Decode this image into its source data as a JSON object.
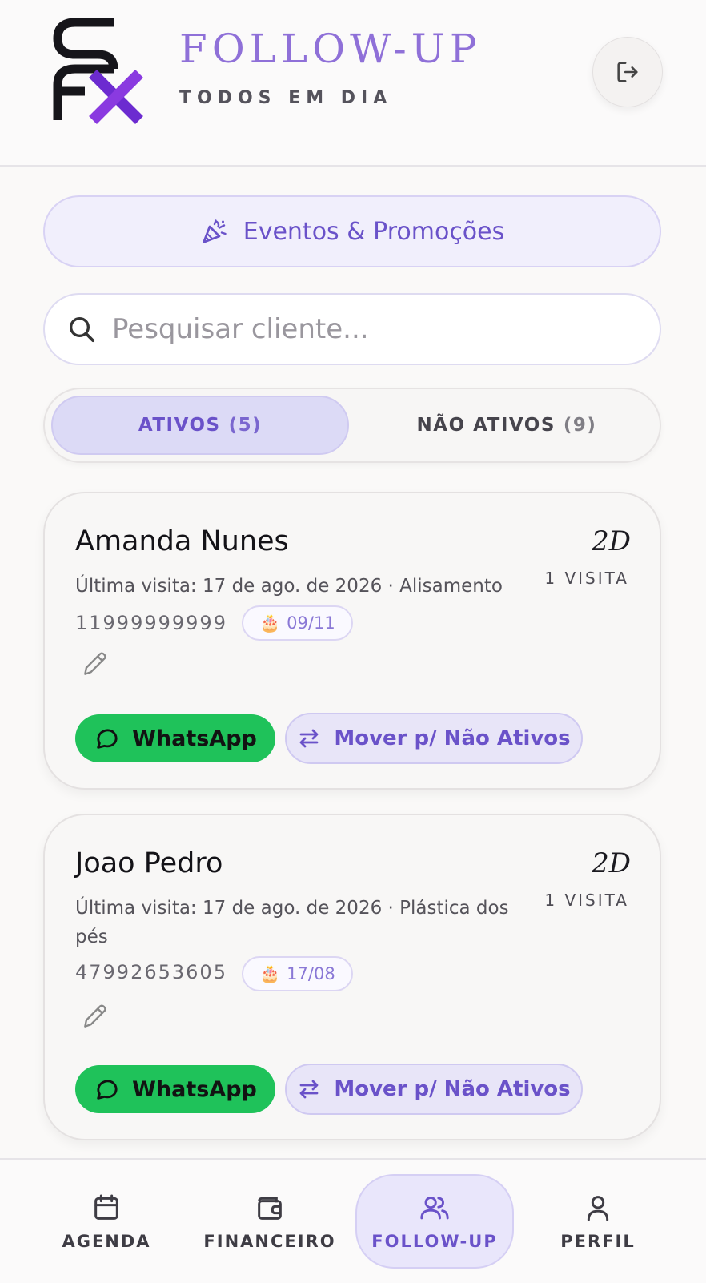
{
  "header": {
    "logo_text": "SFX",
    "title": "FOLLOW-UP",
    "subtitle": "TODOS EM DIA",
    "logout_icon": "logout-icon"
  },
  "promo": {
    "label": "Eventos & Promoções",
    "icon": "party-popper-icon"
  },
  "search": {
    "placeholder": "Pesquisar cliente...",
    "value": ""
  },
  "tabs": [
    {
      "label": "ATIVOS",
      "count": "(5)",
      "active": true
    },
    {
      "label": "NÃO ATIVOS",
      "count": "(9)",
      "active": false
    }
  ],
  "clients": [
    {
      "name": "Amanda Nunes",
      "days": "2D",
      "visits": "1 VISITA",
      "last_visit": "Última visita: 17 de ago. de 2026 · Alisamento",
      "phone": "11999999999",
      "birthday": "09/11",
      "whatsapp_label": "WhatsApp",
      "move_label": "Mover p/ Não Ativos"
    },
    {
      "name": "Joao Pedro",
      "days": "2D",
      "visits": "1 VISITA",
      "last_visit": "Última visita: 17 de ago. de 2026 · Plástica dos pés",
      "phone": "47992653605",
      "birthday": "17/08",
      "whatsapp_label": "WhatsApp",
      "move_label": "Mover p/ Não Ativos"
    }
  ],
  "nav": [
    {
      "label": "AGENDA",
      "icon": "calendar-icon"
    },
    {
      "label": "FINANCEIRO",
      "icon": "wallet-icon"
    },
    {
      "label": "FOLLOW-UP",
      "icon": "users-icon",
      "active": true
    },
    {
      "label": "PERFIL",
      "icon": "user-icon"
    }
  ],
  "colors": {
    "accent": "#6a52c9",
    "whatsapp": "#1fc25a",
    "logo_x": "#7b2fd8"
  }
}
